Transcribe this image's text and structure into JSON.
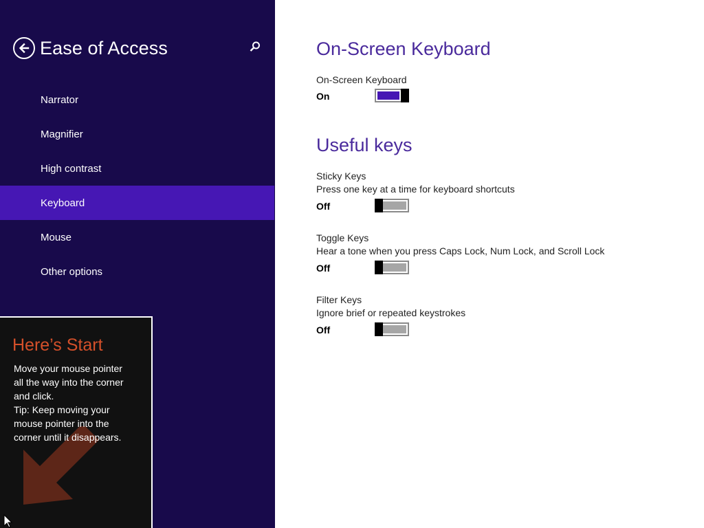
{
  "sidebar": {
    "title": "Ease of Access",
    "back_icon": "back-arrow-icon",
    "search_icon": "search-icon",
    "items": [
      {
        "label": "Narrator",
        "selected": false
      },
      {
        "label": "Magnifier",
        "selected": false
      },
      {
        "label": "High contrast",
        "selected": false
      },
      {
        "label": "Keyboard",
        "selected": true
      },
      {
        "label": "Mouse",
        "selected": false
      },
      {
        "label": "Other options",
        "selected": false
      }
    ]
  },
  "start_tip": {
    "title": "Here’s Start",
    "body_lines": [
      "Move your mouse pointer",
      "all the way into the corner",
      "and click.",
      "Tip: Keep moving your",
      "mouse pointer into the",
      "corner until it disappears."
    ],
    "arrow_icon": "arrow-down-left-icon"
  },
  "content": {
    "onscreen": {
      "heading": "On-Screen Keyboard",
      "label": "On-Screen Keyboard",
      "state": "On",
      "on": true
    },
    "useful_keys": {
      "heading": "Useful keys",
      "settings": [
        {
          "label": "Sticky Keys",
          "description": "Press one key at a time for keyboard shortcuts",
          "state": "Off",
          "on": false
        },
        {
          "label": "Toggle Keys",
          "description": "Hear a tone when you press Caps Lock, Num Lock, and Scroll Lock",
          "state": "Off",
          "on": false
        },
        {
          "label": "Filter Keys",
          "description": "Ignore brief or repeated keystrokes",
          "state": "Off",
          "on": false
        }
      ]
    }
  },
  "colors": {
    "sidebar_bg": "#180a4b",
    "selected_bg": "#4617b4",
    "heading": "#4a2a9c",
    "tip_title": "#d4502a",
    "toggle_on": "#4617b4",
    "toggle_off": "#a6a6a6"
  }
}
